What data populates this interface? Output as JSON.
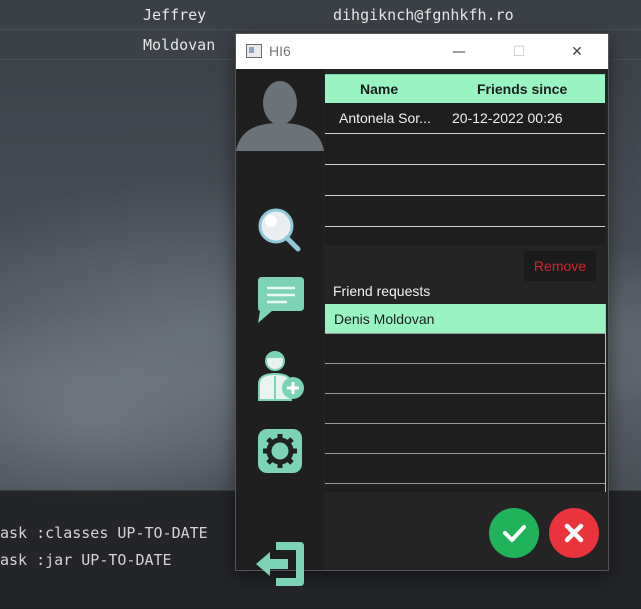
{
  "background": {
    "rows": [
      {
        "name": "Jeffrey",
        "email": "dihgiknch@fgnhkfh.ro"
      },
      {
        "name": "Moldovan",
        "email": ""
      }
    ],
    "console_lines": [
      "ask :classes UP-TO-DATE",
      "ask :jar UP-TO-DATE"
    ]
  },
  "window": {
    "title": "HI6",
    "minimize_glyph": "—",
    "maximize_glyph": "☐",
    "close_glyph": "✕"
  },
  "sidebar": {
    "icons": [
      "avatar-icon",
      "search-icon",
      "chat-icon",
      "add-friend-icon",
      "settings-icon",
      "logout-icon"
    ]
  },
  "friends": {
    "headers": {
      "name": "Name",
      "since": "Friends since"
    },
    "rows": [
      {
        "name": "Antonela Sor...",
        "since": "20-12-2022 00:26"
      }
    ]
  },
  "remove_label": "Remove",
  "requests": {
    "label": "Friend requests",
    "items": [
      "Denis Moldovan"
    ]
  },
  "colors": {
    "accent": "#98f5c2",
    "accept": "#21b35a",
    "decline": "#e8343a",
    "remove_text": "#d4242a",
    "icon_mint": "#7dd3b5"
  }
}
